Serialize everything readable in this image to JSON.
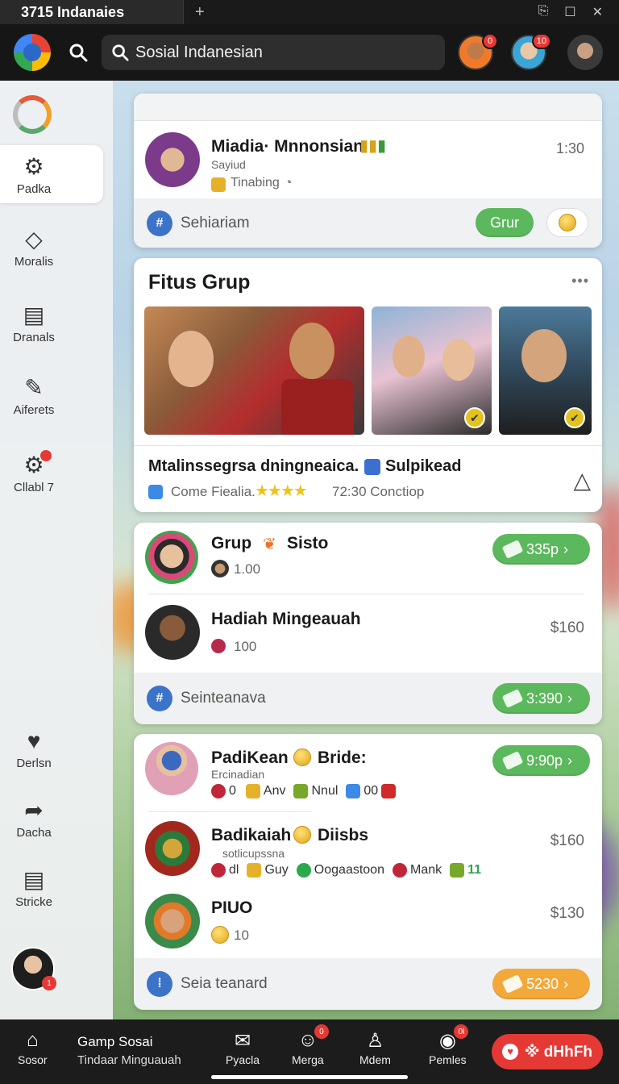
{
  "titlebar": {
    "tab_title": "3715 Indanaies",
    "new_tab": "+"
  },
  "header": {
    "search_placeholder": "Sosial Indanesian",
    "avatars": [
      {
        "badge": "0"
      },
      {
        "badge": "10"
      },
      {
        "badge": ""
      }
    ]
  },
  "sidebar": {
    "items": [
      {
        "label": "Padka",
        "icon": "gear-icon"
      },
      {
        "label": "Moralis",
        "icon": "diamond-icon"
      },
      {
        "label": "Dranals",
        "icon": "document-icon"
      },
      {
        "label": "Aiferets",
        "icon": "pencil-icon"
      },
      {
        "label": "Cllabl 7",
        "icon": "gear-icon"
      },
      {
        "label": "Derlsn",
        "icon": "heart-pin-icon"
      },
      {
        "label": "Dacha",
        "icon": "share-icon"
      },
      {
        "label": "Stricke",
        "icon": "document-icon"
      }
    ],
    "user_badge": "1"
  },
  "card1": {
    "name": "Miadia· Mnnonsian",
    "status": "Sayiud",
    "activity": "Tinabing",
    "time": "1:30",
    "footer_label": "Sehiariam",
    "footer_button": "Grur"
  },
  "card2": {
    "title": "Fitus Grup",
    "more": "•••",
    "caption": "Mtalinssegrsa dningneaica.",
    "caption_tag": "Sulpikead",
    "meta_left": "Come Fiealia.",
    "meta_right": "72:30 Conctiop"
  },
  "card3": {
    "rows": [
      {
        "name": "Grup",
        "tag": "Sisto",
        "count": "1.00",
        "pill": "335p"
      },
      {
        "name": "Hadiah Mingeauah",
        "count": "100",
        "price": "$160"
      }
    ],
    "footer_label": "Seinteanava",
    "footer_pill": "3:390"
  },
  "card4": {
    "rows": [
      {
        "name": "PadiKean",
        "name2": "Bride:",
        "sub": "Ercinadian",
        "items": [
          "0",
          "Anv",
          "Nnul",
          "00"
        ],
        "pill": "9:90p"
      },
      {
        "name": "Badikaiah",
        "name2": "Diisbs",
        "sub": "sotlicupssna",
        "items": [
          "dl",
          "Guy",
          "Oogaastoon",
          "Mank",
          "11"
        ],
        "price": "$160"
      },
      {
        "name": "PIUO",
        "count": "10",
        "price": "$130"
      }
    ],
    "footer_label": "Seia teanard",
    "footer_pill": "5230"
  },
  "bottom_nav": {
    "items": [
      {
        "label": "Sosor",
        "icon": "home-icon"
      },
      {
        "label": "Pyacla",
        "icon": "mail-icon"
      },
      {
        "label": "Merga",
        "icon": "smile-icon",
        "badge": "0"
      },
      {
        "label": "Mdem",
        "icon": "bell-icon"
      },
      {
        "label": "Pemles",
        "icon": "user-icon",
        "badge": "0l"
      }
    ],
    "group_title": "Gamp Sosai",
    "group_sub": "Tindaar Minguauah",
    "primary_button": "※ dHhFh"
  }
}
